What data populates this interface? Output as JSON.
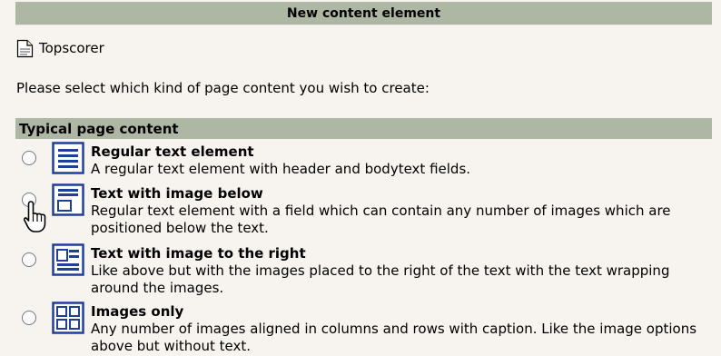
{
  "header": {
    "title": "New content element"
  },
  "page": {
    "name": "Topscorer"
  },
  "instruction": "Please select which kind of page content you wish to create:",
  "section": {
    "title": "Typical page content"
  },
  "items": [
    {
      "icon": "text-element-icon",
      "title": "Regular text element",
      "description": "A regular text element with header and bodytext fields.",
      "selected": false
    },
    {
      "icon": "text-with-image-below-icon",
      "title": "Text with image below",
      "description": "Regular text element with a field which can contain any number of images which are positioned below the text.",
      "selected": false
    },
    {
      "icon": "text-with-image-right-icon",
      "title": "Text with image to the right",
      "description": "Like above but with the images placed to the right of the text with the text wrapping around the images.",
      "selected": false
    },
    {
      "icon": "images-only-icon",
      "title": "Images only",
      "description": "Any number of images aligned in columns and rows with caption. Like the image options above but without text.",
      "selected": false
    }
  ],
  "colors": {
    "background": "#f7f3ef",
    "header_bar": "#aeb7a4",
    "icon_blue": "#1f3f9a"
  },
  "cursor": "hand-pointer-icon"
}
